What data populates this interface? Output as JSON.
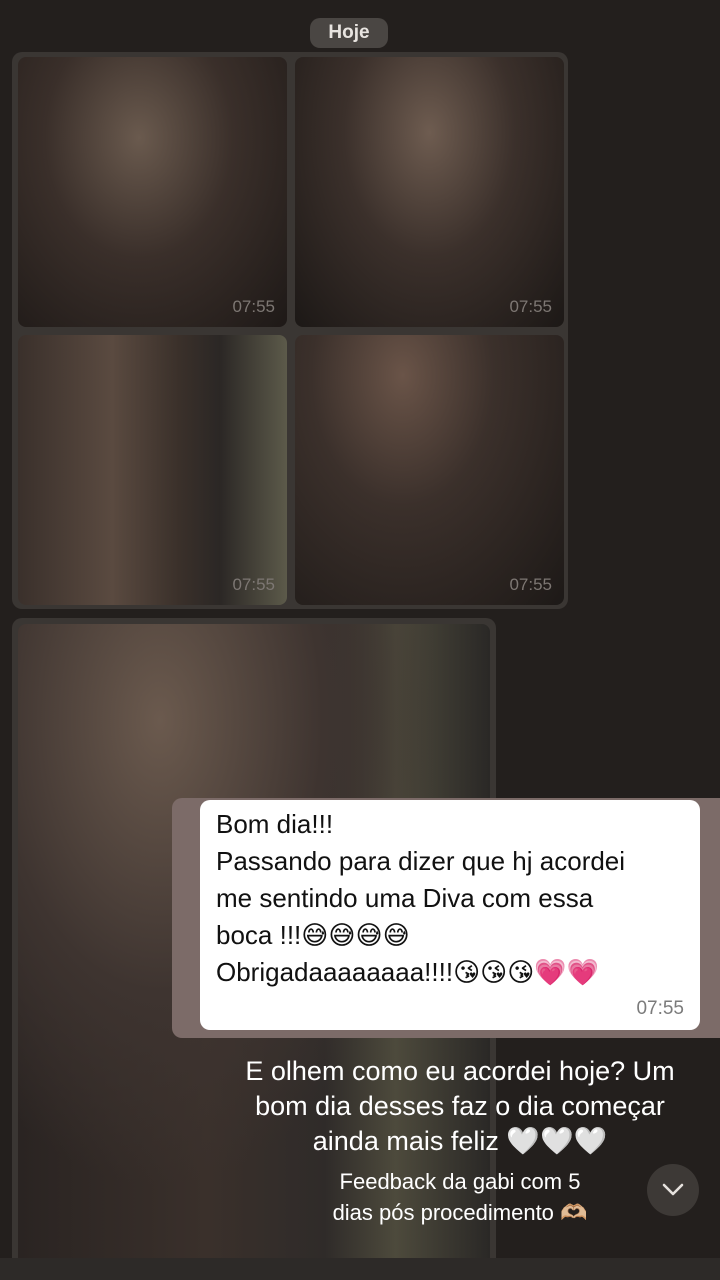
{
  "date_divider": "Hoje",
  "album": {
    "photos": [
      {
        "time": "07:55"
      },
      {
        "time": "07:55"
      },
      {
        "time": "07:55"
      },
      {
        "time": "07:55"
      }
    ]
  },
  "message": {
    "lines": [
      "Bom dia!!!",
      "Passando para dizer que hj acordei",
      "me sentindo uma Diva com essa",
      "boca !!!😅😅😅😅",
      "Obrigadaaaaaaaa!!!!😘😘😘💗💗"
    ],
    "time": "07:55"
  },
  "caption": {
    "main_lines": [
      "E olhem como eu acordei hoje? Um",
      "bom dia desses faz o dia começar",
      "ainda mais feliz 🤍🤍🤍"
    ],
    "sub_lines": [
      "Feedback da gabi com 5",
      "dias pós procedimento 🫶🏼"
    ]
  },
  "icons": {
    "scroll_down": "chevron-down-icon"
  },
  "colors": {
    "background": "#231f1d",
    "bubble": "#ffffff",
    "bubble_band": "#7c6b68"
  }
}
